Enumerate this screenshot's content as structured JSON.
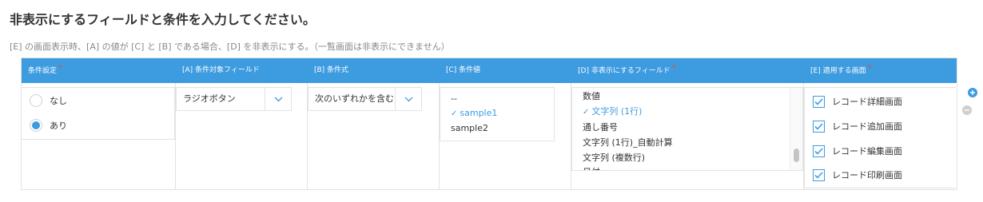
{
  "heading": "非表示にするフィールドと条件を入力してください。",
  "description": "[E] の画面表示時、[A] の値が [C] と [B] である場合、[D] を非表示にする。（一覧画面は非表示にできません）",
  "columns": {
    "condition_setting": "条件設定",
    "target_field": "[A] 条件対象フィールド",
    "operator": "[B] 条件式",
    "value": "[C] 条件値",
    "hidden_fields": "[D] 非表示にするフィールド",
    "screens": "[E] 適用する画面"
  },
  "required_mark": "*",
  "condition_options": [
    {
      "label": "なし",
      "selected": false
    },
    {
      "label": "あり",
      "selected": true
    }
  ],
  "target_field_select": {
    "value": "ラジオボタン"
  },
  "operator_select": {
    "value": "次のいずれかを含む"
  },
  "value_list": [
    {
      "label": "--",
      "selected": false
    },
    {
      "label": "sample1",
      "selected": true
    },
    {
      "label": "sample2",
      "selected": false
    }
  ],
  "hidden_field_list": [
    {
      "label": "数値",
      "selected": false
    },
    {
      "label": "文字列 (1行)",
      "selected": true
    },
    {
      "label": "通し番号",
      "selected": false
    },
    {
      "label": "文字列 (1行)_自動計算",
      "selected": false
    },
    {
      "label": "文字列 (複数行)",
      "selected": false
    },
    {
      "label": "日付",
      "selected": false
    }
  ],
  "screen_options": [
    {
      "label": "レコード詳細画面",
      "checked": true
    },
    {
      "label": "レコード追加画面",
      "checked": true
    },
    {
      "label": "レコード編集画面",
      "checked": true
    },
    {
      "label": "レコード印刷画面",
      "checked": true
    }
  ],
  "colors": {
    "accent": "#3d9be0",
    "required": "#e74c3c",
    "remove": "#cfcfcf"
  },
  "icons": {
    "add": "plus-circle-icon",
    "remove": "minus-circle-icon",
    "check": "checkmark-icon",
    "chevron": "chevron-down-icon"
  }
}
